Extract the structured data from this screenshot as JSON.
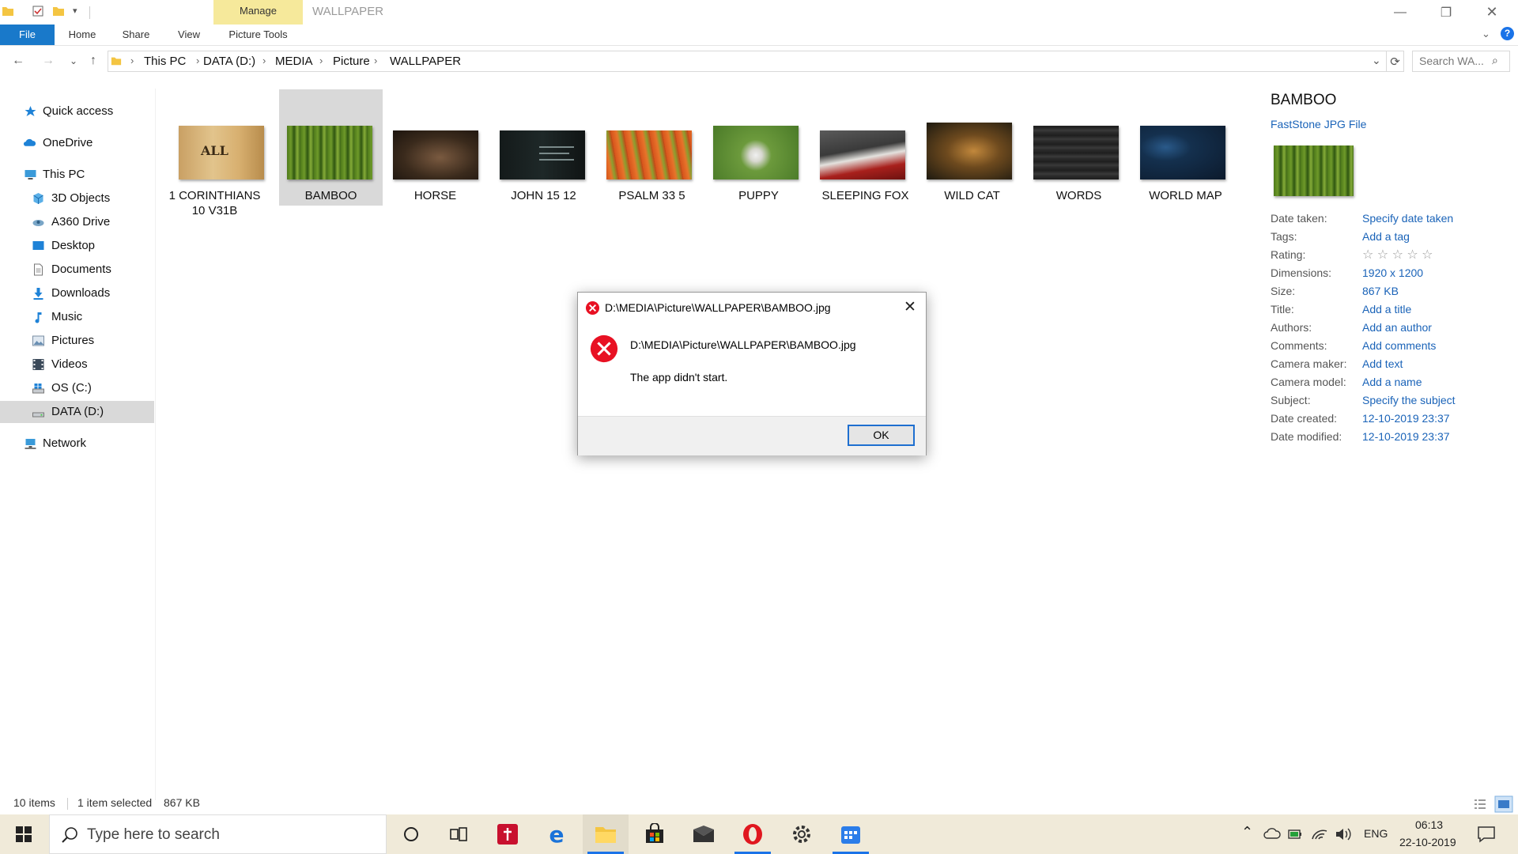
{
  "window": {
    "title": "WALLPAPER",
    "controls": {
      "minimize": "—",
      "maximize": "❐",
      "close": "✕"
    }
  },
  "ribbon": {
    "contextual_tab": "Manage",
    "tabs": [
      "File",
      "Home",
      "Share",
      "View",
      "Picture Tools"
    ]
  },
  "address": {
    "crumbs": [
      "This PC",
      "DATA (D:)",
      "MEDIA",
      "Picture",
      "WALLPAPER"
    ],
    "search_placeholder": "Search WA..."
  },
  "sidebar": {
    "items": [
      {
        "label": "Quick access",
        "icon": "star-icon"
      },
      {
        "label": "OneDrive",
        "icon": "cloud-icon"
      },
      {
        "label": "This PC",
        "icon": "computer-icon"
      },
      {
        "label": "3D Objects",
        "icon": "cube-icon"
      },
      {
        "label": "A360 Drive",
        "icon": "drive-icon"
      },
      {
        "label": "Desktop",
        "icon": "desktop-icon"
      },
      {
        "label": "Documents",
        "icon": "document-icon"
      },
      {
        "label": "Downloads",
        "icon": "download-icon"
      },
      {
        "label": "Music",
        "icon": "music-icon"
      },
      {
        "label": "Pictures",
        "icon": "pictures-icon"
      },
      {
        "label": "Videos",
        "icon": "video-icon"
      },
      {
        "label": "OS (C:)",
        "icon": "os-drive-icon"
      },
      {
        "label": "DATA (D:)",
        "icon": "data-drive-icon",
        "selected": true
      },
      {
        "label": "Network",
        "icon": "network-icon"
      }
    ]
  },
  "files": [
    {
      "name": "1 CORINTHIANS 10 V31B",
      "line1": "1 CORINTHIANS",
      "line2": "10 V31B"
    },
    {
      "name": "BAMBOO",
      "line1": "BAMBOO",
      "line2": "",
      "selected": true
    },
    {
      "name": "HORSE",
      "line1": "HORSE",
      "line2": ""
    },
    {
      "name": "JOHN 15 12",
      "line1": "JOHN 15 12",
      "line2": ""
    },
    {
      "name": "PSALM 33 5",
      "line1": "PSALM 33 5",
      "line2": ""
    },
    {
      "name": "PUPPY",
      "line1": "PUPPY",
      "line2": ""
    },
    {
      "name": "SLEEPING FOX",
      "line1": "SLEEPING FOX",
      "line2": ""
    },
    {
      "name": "WILD CAT",
      "line1": "WILD CAT",
      "line2": ""
    },
    {
      "name": "WORDS",
      "line1": "WORDS",
      "line2": ""
    },
    {
      "name": "WORLD MAP",
      "line1": "WORLD MAP",
      "line2": ""
    }
  ],
  "details": {
    "name": "BAMBOO",
    "type": "FastStone JPG File",
    "properties": [
      {
        "key": "Date taken:",
        "value": "Specify date taken"
      },
      {
        "key": "Tags:",
        "value": "Add a tag"
      },
      {
        "key": "Rating:",
        "value": "☆ ☆ ☆ ☆ ☆"
      },
      {
        "key": "Dimensions:",
        "value": "1920 x 1200"
      },
      {
        "key": "Size:",
        "value": "867 KB"
      },
      {
        "key": "Title:",
        "value": "Add a title"
      },
      {
        "key": "Authors:",
        "value": "Add an author"
      },
      {
        "key": "Comments:",
        "value": "Add comments"
      },
      {
        "key": "Camera maker:",
        "value": "Add text"
      },
      {
        "key": "Camera model:",
        "value": "Add a name"
      },
      {
        "key": "Subject:",
        "value": "Specify the subject"
      },
      {
        "key": "Date created:",
        "value": "12-10-2019 23:37"
      },
      {
        "key": "Date modified:",
        "value": "12-10-2019 23:37"
      }
    ]
  },
  "dialog": {
    "title": "D:\\MEDIA\\Picture\\WALLPAPER\\BAMBOO.jpg",
    "message_path": "D:\\MEDIA\\Picture\\WALLPAPER\\BAMBOO.jpg",
    "message": "The app didn't start.",
    "ok_label": "OK"
  },
  "status": {
    "item_count": "10 items",
    "selection": "1 item selected",
    "size": "867 KB"
  },
  "taskbar": {
    "search_placeholder": "Type here to search",
    "apps": [
      "cortana-icon",
      "task-view-icon",
      "bible-app-icon",
      "edge-icon",
      "file-explorer-icon",
      "store-icon",
      "mail-icon",
      "opera-icon",
      "settings-icon",
      "calendar-app-icon"
    ],
    "language": "ENG",
    "time": "06:13",
    "date": "22-10-2019"
  },
  "colors": {
    "accent": "#1979ca",
    "manage_tab": "#f6e99b",
    "link": "#1a63b8",
    "selection": "#d9d9d9",
    "error": "#e81123",
    "taskbar": "#f0ead9"
  }
}
